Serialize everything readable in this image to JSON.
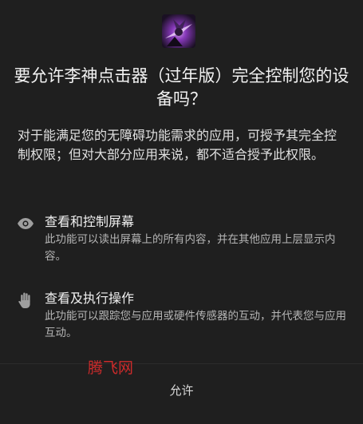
{
  "dialog": {
    "title": "要允许李神点击器（过年版）完全控制您的设备吗？",
    "intro": "对于能满足您的无障碍功能需求的应用，可授予其完全控制权限；但对大部分应用来说，都不适合授予此权限。",
    "permissions": [
      {
        "icon": "eye-icon",
        "title": "查看和控制屏幕",
        "description": "此功能可以读出屏幕上的所有内容，并在其他应用上层显示内容。"
      },
      {
        "icon": "hand-icon",
        "title": "查看及执行操作",
        "description": "此功能可以跟踪您与应用或硬件传感器的互动，并代表您与应用互动。"
      }
    ],
    "allow_label": "允许"
  },
  "watermark": "腾飞网",
  "colors": {
    "background": "#1f1f1f",
    "watermark": "#cc2b2b"
  }
}
